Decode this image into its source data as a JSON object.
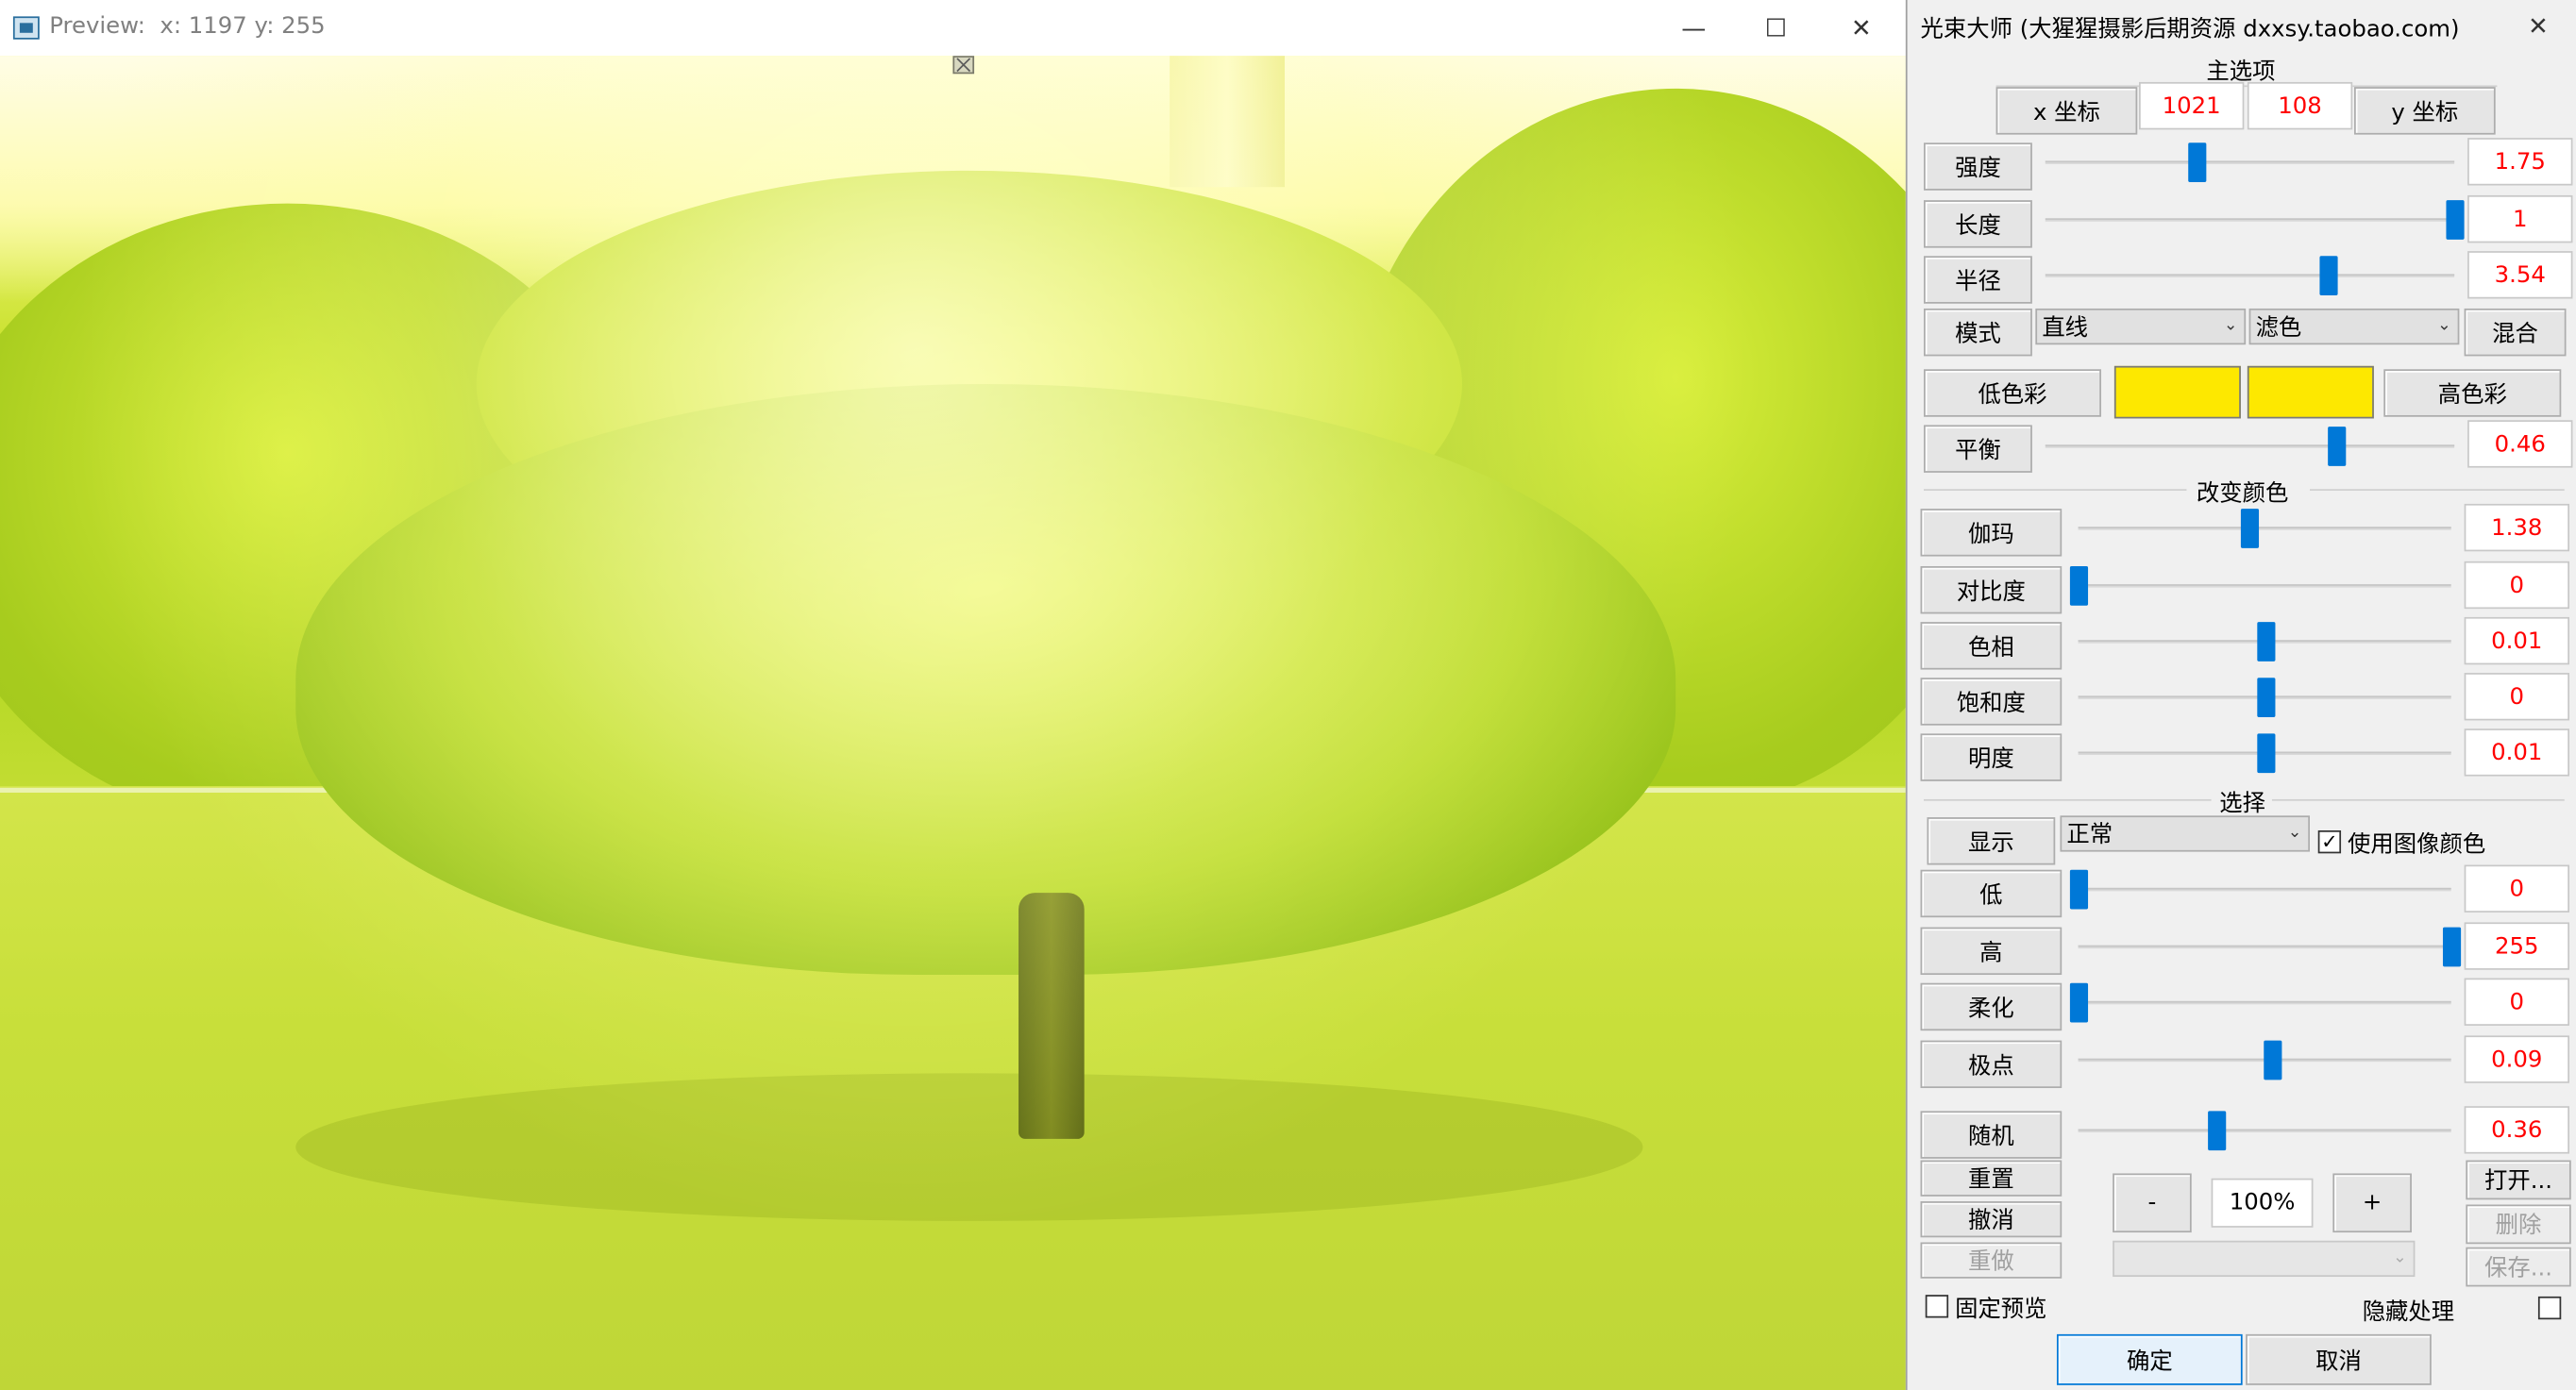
{
  "preview": {
    "title": "Preview:  x: 1197 y: 255"
  },
  "panel": {
    "title": "光束大师 (大猩猩摄影后期资源 dxxsy.taobao.com)",
    "main_section": "主选项",
    "x_label": "x 坐标",
    "x_value": "1021",
    "y_value": "108",
    "y_label": "y 坐标",
    "main_sliders": [
      {
        "label": "强度",
        "value": "1.75",
        "position": 0.37
      },
      {
        "label": "长度",
        "value": "1",
        "position": 1.0
      },
      {
        "label": "半径",
        "value": "3.54",
        "position": 0.69
      }
    ],
    "mode_label": "模式",
    "mode_select": "直线",
    "blend_select": "滤色",
    "blend_button": "混合",
    "low_color_label": "低色彩",
    "high_color_label": "高色彩",
    "low_color": "#fde800",
    "high_color": "#fde800",
    "balance": {
      "label": "平衡",
      "value": "0.46",
      "position": 0.71
    },
    "color_section": "改变颜色",
    "color_sliders": [
      {
        "label": "伽玛",
        "value": "1.38",
        "position": 0.46
      },
      {
        "label": "对比度",
        "value": "0",
        "position": 0.0
      },
      {
        "label": "色相",
        "value": "0.01",
        "position": 0.5
      },
      {
        "label": "饱和度",
        "value": "0",
        "position": 0.5
      },
      {
        "label": "明度",
        "value": "0.01",
        "position": 0.5
      }
    ],
    "select_section": "选择",
    "display_label": "显示",
    "display_select": "正常",
    "use_image_color": "使用图像颜色",
    "use_image_color_checked": true,
    "select_sliders": [
      {
        "label": "低",
        "value": "0",
        "position": 0.0
      },
      {
        "label": "高",
        "value": "255",
        "position": 1.0
      },
      {
        "label": "柔化",
        "value": "0",
        "position": 0.0
      },
      {
        "label": "极点",
        "value": "0.09",
        "position": 0.52
      }
    ],
    "random": {
      "label": "随机",
      "value": "0.36",
      "position": 0.37
    },
    "reset": "重置",
    "undo": "撤消",
    "redo": "重做",
    "zoom_minus": "-",
    "zoom_value": "100%",
    "zoom_plus": "+",
    "open": "打开...",
    "delete": "删除",
    "save": "保存...",
    "fixed_preview": "固定预览",
    "hide_process": "隐藏处理",
    "ok": "确定",
    "cancel": "取消"
  }
}
